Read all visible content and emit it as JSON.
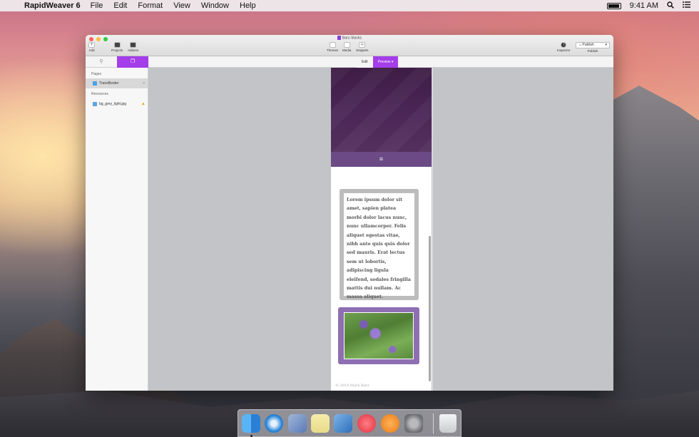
{
  "menubar": {
    "app_name": "RapidWeaver 6",
    "items": [
      "File",
      "Edit",
      "Format",
      "View",
      "Window",
      "Help"
    ],
    "clock": "9:41 AM"
  },
  "window": {
    "title": "Barz-Stacks",
    "toolbar": {
      "add": "Add",
      "projects": "Projects",
      "addons": "Addons",
      "themes": "Themes",
      "media": "Media",
      "snippets": "Snippets",
      "inspector": "Inspector",
      "publish_button": "Publish",
      "publish": "Publish"
    },
    "mode_tabs": {
      "edit": "Edit",
      "preview": "Preview"
    }
  },
  "sidebar": {
    "pages_header": "Pages",
    "pages": [
      {
        "label": "TransBorder"
      }
    ],
    "resources_header": "Resources",
    "resources": [
      {
        "label": "bg_grey_light.jpg"
      }
    ]
  },
  "preview": {
    "lorem": "Lorem ipsum dolor sit amet, sapien platea morbi dolor lacus nunc, nunc ullamcorper. Felis aliquet egestas vitae, nibh ante quis quis dolor sed mauris. Erat lectus sem ut lobortis, adipiscing ligula eleifend, sodales fringilla mattis dui nullam. Ac massa aliquet.",
    "footer": "© 2014 Mark Barz",
    "menu_icon": "≡"
  },
  "dock": {
    "apps": [
      "finder-icon",
      "safari-icon",
      "preview-icon",
      "notes-icon",
      "xcode-icon",
      "itunes-icon",
      "ibooks-icon",
      "system-preferences-icon",
      "trash-icon"
    ],
    "colors": [
      "#3d9be9",
      "#2a86d9",
      "#5a7ab8",
      "#f2e8a0",
      "#4a84c6",
      "#e8404f",
      "#f08a24",
      "#7b7b82",
      "#d9dadd"
    ]
  }
}
